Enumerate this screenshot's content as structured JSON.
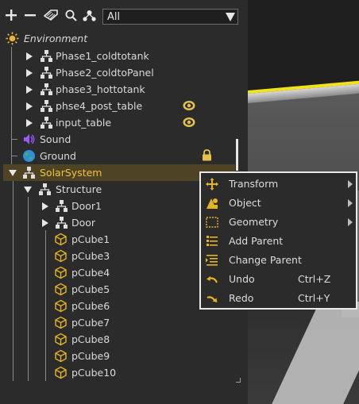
{
  "toolbar": {
    "add_icon": "plus-icon",
    "remove_icon": "minus-icon",
    "tag_icon": "tag-icon",
    "search_icon": "search-icon",
    "hierarchy_icon": "hierarchy-icon",
    "filter": {
      "selected": "All"
    }
  },
  "tree": {
    "environment": "Environment",
    "phase1": "Phase1_coldtotank",
    "phase2": "Phase2_coldtoPanel",
    "phase3": "phase3_hottotank",
    "phase4": "phse4_post_table",
    "input_table": "input_table",
    "sound": "Sound",
    "ground": "Ground",
    "solar": "SolarSystem",
    "structure": "Structure",
    "door1": "Door1",
    "door": "Door",
    "cubes": [
      "pCube1",
      "pCube3",
      "pCube4",
      "pCube5",
      "pCube6",
      "pCube7",
      "pCube8",
      "pCube9",
      "pCube10"
    ]
  },
  "context_menu": {
    "transform": "Transform",
    "object": "Object",
    "geometry": "Geometry",
    "add_parent": "Add Parent",
    "change_parent": "Change Parent",
    "undo": "Undo",
    "undo_shortcut": "Ctrl+Z",
    "redo": "Redo",
    "redo_shortcut": "Ctrl+Y"
  },
  "colors": {
    "accent": "#f0c23a",
    "selected_row": "#4e4425",
    "panel_bg": "#2b2b2b",
    "viewport_edge": "#f2e21a"
  }
}
